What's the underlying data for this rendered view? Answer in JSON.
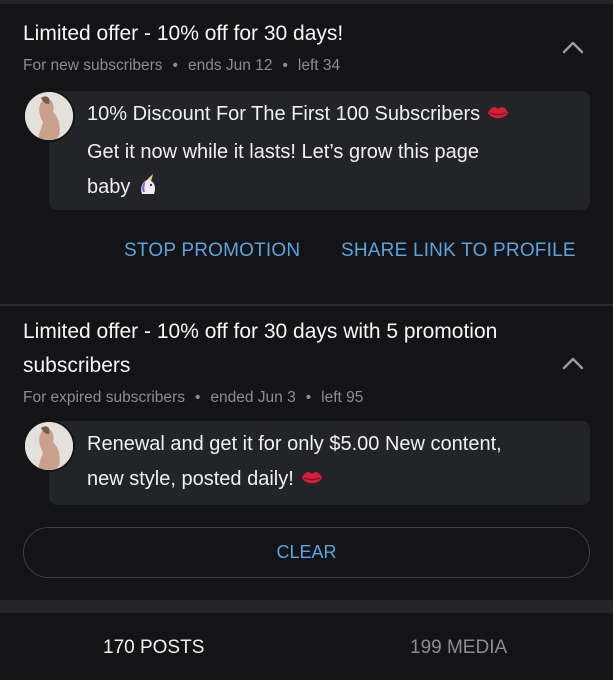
{
  "promotions": [
    {
      "title": "Limited offer - 10% off for 30 days!",
      "audience": "For new subscribers",
      "ends": "ends Jun 12",
      "left": "left 34",
      "message_line1": "10% Discount For The First 100 Subscribers",
      "message_line2": "Get it now while it lasts! Let’s grow this page",
      "message_line3": "baby",
      "emoji1": "kiss-lips-icon",
      "emoji2": "unicorn-icon"
    },
    {
      "title": "Limited offer - 10% off for 30 days with 5 promotion subscribers",
      "audience": "For expired subscribers",
      "ends": "ended Jun 3",
      "left": "left 95",
      "message_line1": "Renewal and get it for only $5.00 New content,",
      "message_line2": "new style, posted daily!",
      "emoji1": "kiss-lips-icon"
    }
  ],
  "actions": {
    "stop_promotion": "STOP PROMOTION",
    "share_link": "SHARE LINK TO PROFILE",
    "clear": "CLEAR"
  },
  "tabs": {
    "posts": "170 POSTS",
    "media": "199 MEDIA"
  },
  "colors": {
    "background": "#141416",
    "card": "#232428",
    "accent": "#5aa4e0",
    "muted": "#8b8d93"
  }
}
